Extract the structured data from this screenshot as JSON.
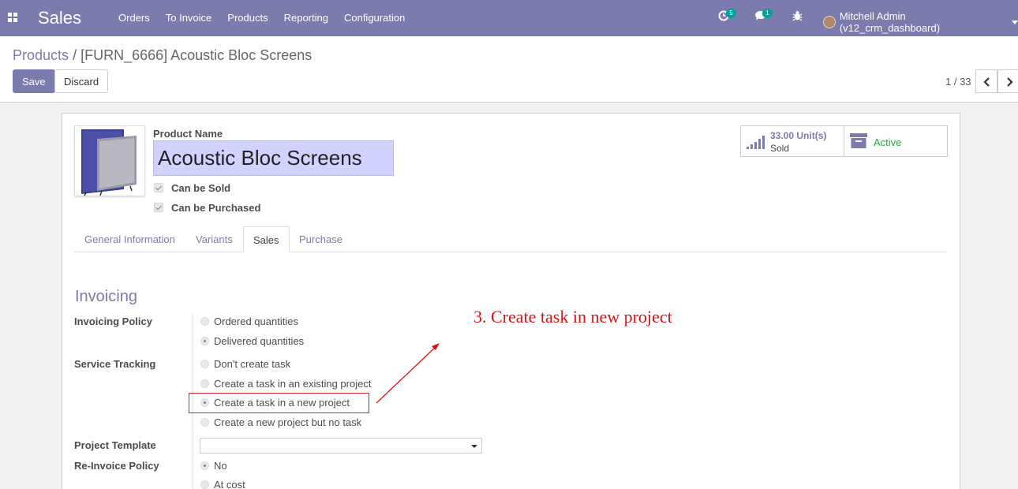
{
  "navbar": {
    "app_name": "Sales",
    "menu": [
      "Orders",
      "To Invoice",
      "Products",
      "Reporting",
      "Configuration"
    ],
    "activity_count": "5",
    "message_count": "1",
    "user": "Mitchell Admin (v12_crm_dashboard)",
    "bg_color": "#7c7bad"
  },
  "breadcrumb": {
    "parent": "Products",
    "separator": "/",
    "current": "[FURN_6666] Acoustic Bloc Screens"
  },
  "buttons": {
    "save": "Save",
    "discard": "Discard"
  },
  "pager": {
    "value": "1 / 33"
  },
  "product": {
    "name_label": "Product Name",
    "name": "Acoustic Bloc Screens",
    "can_be_sold": "Can be Sold",
    "can_be_purchased": "Can be Purchased"
  },
  "stats": {
    "sold_value": "33.00",
    "sold_unit": "Unit(s)",
    "sold_label": "Sold",
    "active_label": "Active"
  },
  "tabs": [
    "General Information",
    "Variants",
    "Sales",
    "Purchase"
  ],
  "invoicing": {
    "title": "Invoicing",
    "policy_label": "Invoicing Policy",
    "policy_options": [
      "Ordered quantities",
      "Delivered quantities"
    ],
    "service_label": "Service Tracking",
    "service_options": [
      "Don't create task",
      "Create a task in an existing project",
      "Create a task in a new project",
      "Create a new project but no task"
    ],
    "template_label": "Project Template",
    "reinvoice_label": "Re-Invoice Policy",
    "reinvoice_options": [
      "No",
      "At cost"
    ]
  },
  "annotation": {
    "text": "3.  Create task in new project",
    "color": "#e01010"
  }
}
